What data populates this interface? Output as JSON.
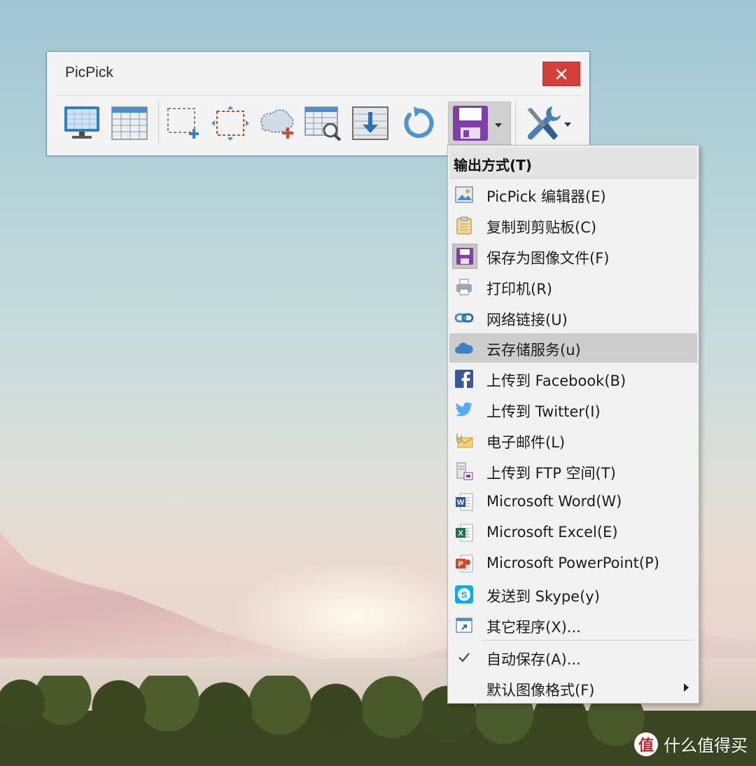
{
  "window": {
    "title": "PicPick",
    "close_symbol": "✕"
  },
  "toolbar": {
    "tools": [
      {
        "name": "capture-screen-icon"
      },
      {
        "name": "capture-window-icon"
      },
      {
        "name": "capture-region-icon"
      },
      {
        "name": "capture-fixed-region-icon"
      },
      {
        "name": "capture-freehand-icon"
      },
      {
        "name": "capture-scrolling-window-icon"
      },
      {
        "name": "capture-repeat-icon"
      },
      {
        "name": "repeat-last-capture-icon"
      },
      {
        "name": "save-output-icon"
      },
      {
        "name": "tools-icon"
      }
    ]
  },
  "menu": {
    "header": "输出方式(T)",
    "items": [
      {
        "label": "PicPick 编辑器(E)",
        "icon": "image-editor-icon"
      },
      {
        "label": "复制到剪贴板(C)",
        "icon": "clipboard-icon"
      },
      {
        "label": "保存为图像文件(F)",
        "icon": "floppy-save-icon"
      },
      {
        "label": "打印机(R)",
        "icon": "printer-icon"
      },
      {
        "label": "网络链接(U)",
        "icon": "link-icon"
      },
      {
        "label": "云存储服务(u)",
        "icon": "cloud-icon"
      },
      {
        "label": "上传到 Facebook(B)",
        "icon": "facebook-icon"
      },
      {
        "label": "上传到 Twitter(I)",
        "icon": "twitter-icon"
      },
      {
        "label": "电子邮件(L)",
        "icon": "email-icon"
      },
      {
        "label": "上传到 FTP 空间(T)",
        "icon": "ftp-icon"
      },
      {
        "label": "Microsoft Word(W)",
        "icon": "word-icon"
      },
      {
        "label": "Microsoft Excel(E)",
        "icon": "excel-icon"
      },
      {
        "label": "Microsoft PowerPoint(P)",
        "icon": "powerpoint-icon"
      },
      {
        "label": "发送到 Skype(y)",
        "icon": "skype-icon"
      },
      {
        "label": "其它程序(X)...",
        "icon": "other-program-icon"
      },
      {
        "label": "自动保存(A)...",
        "icon": "checkmark-icon"
      },
      {
        "label": "默认图像格式(F)",
        "icon": ""
      }
    ]
  },
  "watermark": {
    "symbol": "值",
    "text": "什么值得买"
  },
  "colors": {
    "close_red": "#d43f3a",
    "save_purple": "#7e3fa6",
    "highlight": "#cdcdcd"
  }
}
